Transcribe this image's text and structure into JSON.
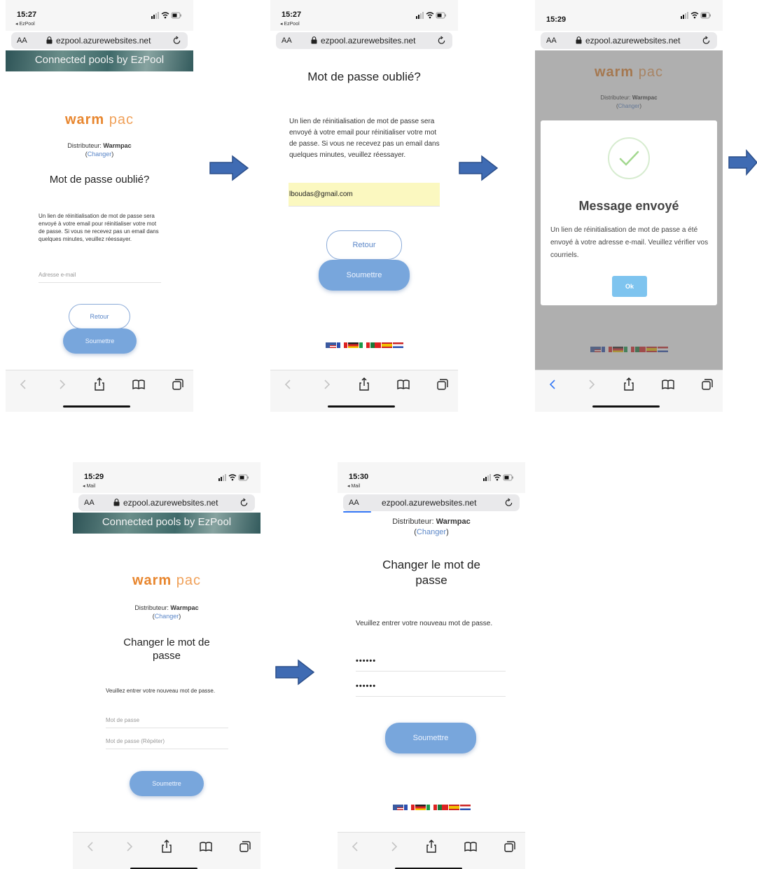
{
  "browser": {
    "url": "ezpool.azurewebsites.net",
    "aa": "AA",
    "back_ezpool": "◂ EzPool",
    "back_mail": "◂ Mail"
  },
  "banner": "Connected pools by EzPool",
  "brand": {
    "logo_main": "warm",
    "logo_pac": "pac"
  },
  "distributor": {
    "label": "Distributeur:",
    "name": "Warmpac",
    "change": "Changer",
    "open": "(",
    "close": ")"
  },
  "screens": [
    {
      "time": "15:27",
      "title": "Mot de passe oublié?",
      "description": "Un lien de réinitialisation de mot de passe sera envoyé à votre email pour réinitialiser votre mot de passe. Si vous ne recevez pas un email dans quelques minutes, veuillez réessayer.",
      "email_placeholder": "Adresse e-mail",
      "back_button": "Retour",
      "submit_button": "Soumettre"
    },
    {
      "time": "15:27",
      "title": "Mot de passe oublié?",
      "description": "Un lien de réinitialisation de mot de passe sera envoyé à votre email pour réinitialiser votre mot de passe. Si vous ne recevez pas un email dans quelques minutes, veuillez réessayer.",
      "email_value": "lboudas@gmail.com",
      "back_button": "Retour",
      "submit_button": "Soumettre"
    },
    {
      "time": "15:29",
      "modal_title": "Message envoyé",
      "modal_text": "Un lien de réinitialisation de mot de passe a été envoyé à votre adresse e-mail. Veuillez vérifier vos courriels.",
      "ok_button": "Ok"
    },
    {
      "time": "15:29",
      "title": "Changer le mot de passe",
      "description": "Veuillez entrer votre nouveau mot de passe.",
      "password_placeholder": "Mot de passe",
      "password_repeat_placeholder": "Mot de passe (Répéter)",
      "submit_button": "Soumettre"
    },
    {
      "time": "15:30",
      "title": "Changer le mot de passe",
      "description": "Veuillez entrer votre nouveau mot de passe.",
      "password_value": "••••••",
      "password_repeat_value": "••••••",
      "submit_button": "Soumettre"
    }
  ],
  "colors": {
    "accent_blue": "#78a6dc",
    "logo_orange": "#e8862e",
    "arrow_blue": "#3f6bb3",
    "email_highlight": "#fbf8c0"
  },
  "icons": [
    "signal-icon",
    "wifi-icon",
    "battery-icon",
    "lock-icon",
    "reload-icon",
    "back-icon",
    "forward-icon",
    "share-icon",
    "bookmarks-icon",
    "tabs-icon",
    "arrow-right-icon",
    "checkmark-icon"
  ],
  "flags": [
    "us",
    "fr",
    "de",
    "it",
    "pt",
    "es",
    "nl"
  ]
}
